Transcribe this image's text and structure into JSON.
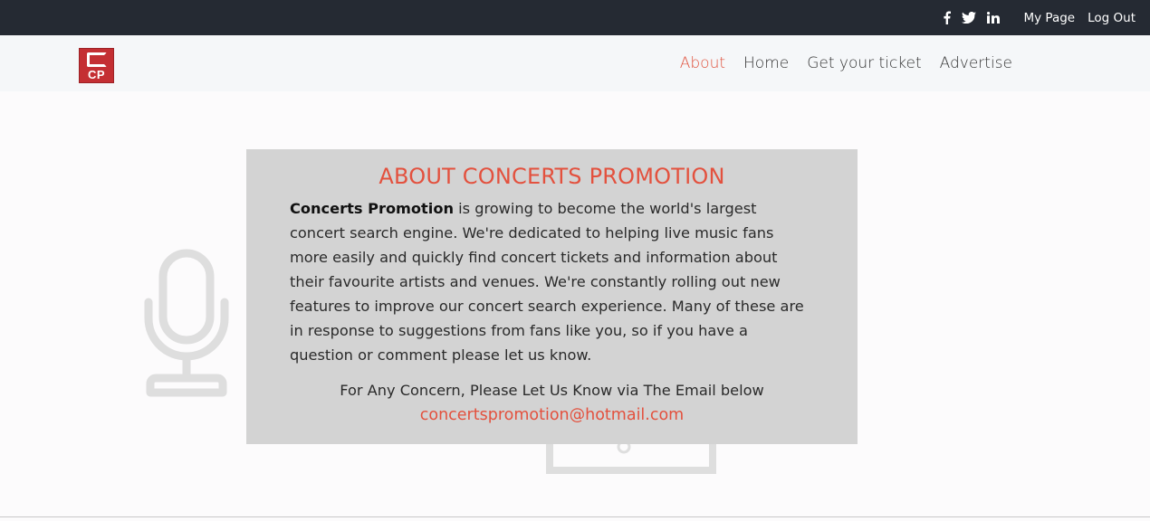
{
  "topbar": {
    "social": [
      {
        "icon": "facebook-icon",
        "glyph": "f"
      },
      {
        "icon": "twitter-icon",
        "glyph": "🐦"
      },
      {
        "icon": "linkedin-icon",
        "glyph": "in"
      }
    ],
    "my_page_label": "My Page",
    "logout_label": "Log Out"
  },
  "navbar": {
    "logo_text": "CP",
    "links": [
      {
        "label": "About",
        "active": true
      },
      {
        "label": "Home",
        "active": false
      },
      {
        "label": "Get your ticket",
        "active": false
      },
      {
        "label": "Advertise",
        "active": false
      }
    ]
  },
  "about": {
    "title": "ABOUT CONCERTS PROMOTION",
    "brand": "Concerts Promotion",
    "body": " is growing to become the world's largest concert search engine. We're dedicated to helping live music fans more easily and quickly find concert tickets and information about their favourite artists and venues. We're constantly rolling out new features to improve our concert search experience. Many of these are in response to suggestions from fans like you, so if you have a question or comment please let us know.",
    "contact_text": "For Any Concern, Please Let Us Know via The Email below",
    "email": "concertspromotion@hotmail.com"
  },
  "colors": {
    "accent": "#e3513e",
    "topbar_bg": "#252a33",
    "card_bg": "#d3d3d3"
  }
}
